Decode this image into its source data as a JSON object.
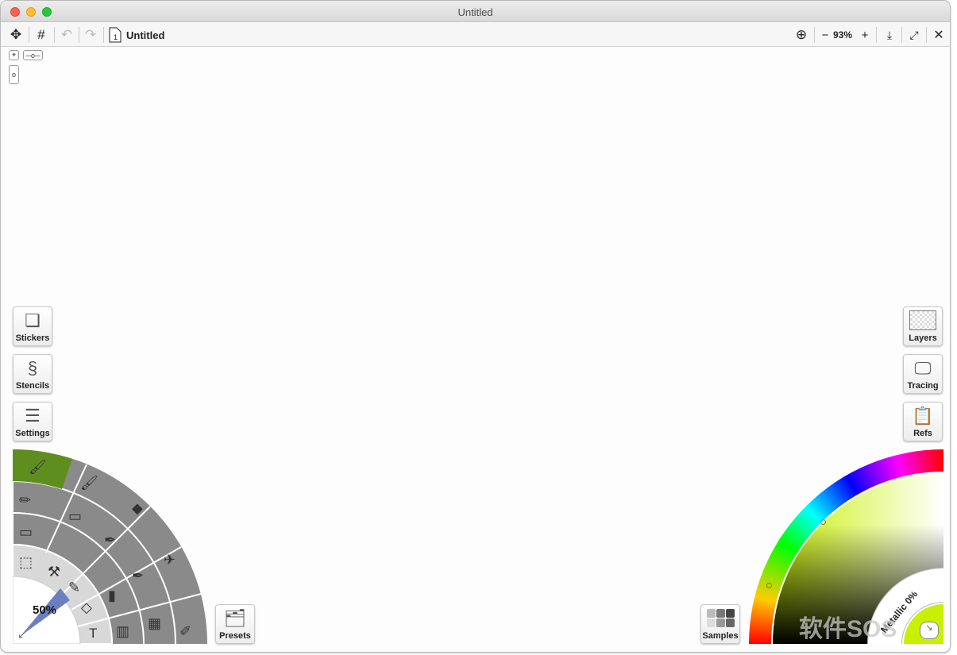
{
  "window": {
    "title": "Untitled"
  },
  "toolbar": {
    "doc_name": "Untitled",
    "zoom": "93%",
    "zoom_out": "−",
    "zoom_in": "+"
  },
  "side_left": [
    {
      "label": "Stickers",
      "icon": "sticker-icon"
    },
    {
      "label": "Stencils",
      "icon": "stencil-icon"
    },
    {
      "label": "Settings",
      "icon": "sliders-icon"
    }
  ],
  "side_right": [
    {
      "label": "Layers",
      "icon": "layers-icon"
    },
    {
      "label": "Tracing",
      "icon": "tracing-icon"
    },
    {
      "label": "Refs",
      "icon": "refs-icon"
    }
  ],
  "tool_wheel": {
    "brush_size": "50%",
    "utility_tools": [
      "selection",
      "fill-roller",
      "eyedropper",
      "bucket",
      "text"
    ],
    "text_tool": "T",
    "selected_tool": "paint-brush"
  },
  "presets": {
    "label": "Presets"
  },
  "samples": {
    "label": "Samples"
  },
  "color_picker": {
    "metallic": "Metallic 0%",
    "current_color": "#c8f000"
  },
  "watermark": "软件SOS"
}
